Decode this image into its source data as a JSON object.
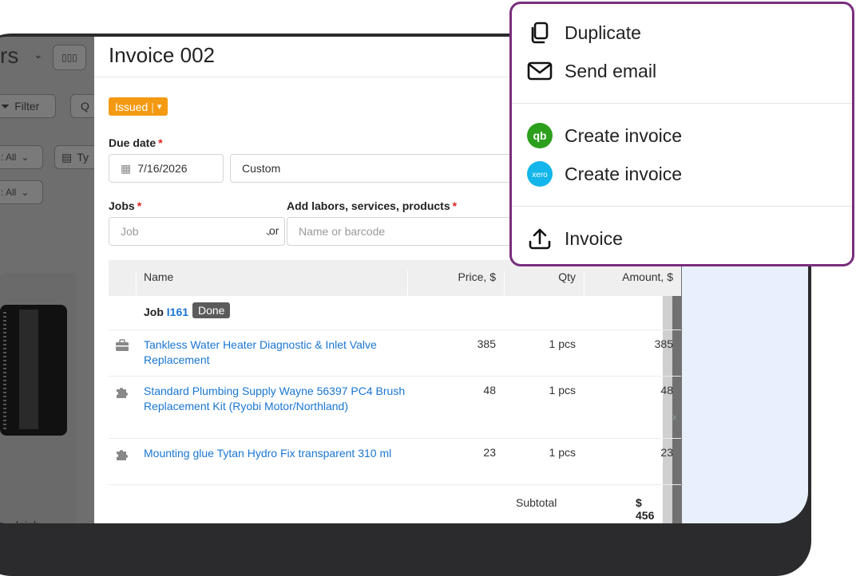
{
  "background": {
    "title_fragment": "rs",
    "filter_label": "Filter",
    "filter2_fragment": "Q",
    "status_filter_1": ": All",
    "status_filter_2": ": All",
    "type_fragment": "Ty",
    "bottom_fragment": "leigh"
  },
  "invoice": {
    "title": "Invoice 002",
    "status": "Issued",
    "due_date_label": "Due date",
    "due_date_value": "7/16/2026",
    "due_term": "Custom",
    "jobs_label": "Jobs",
    "jobs_placeholder": "Job",
    "or_label": "or",
    "add_label": "Add labors, services, products",
    "add_placeholder": "Name or barcode",
    "columns": {
      "name": "Name",
      "price": "Price, $",
      "qty": "Qty",
      "amount": "Amount, $"
    },
    "job_group": {
      "prefix": "Job",
      "id": "I161",
      "badge": "Done"
    },
    "rows": [
      {
        "icon": "toolbox-icon",
        "name": "Tankless Water Heater Diagnostic & Inlet Valve Replacement",
        "price": "385",
        "qty": "1 pcs",
        "amount": "385"
      },
      {
        "icon": "puzzle-icon",
        "name": "Standard Plumbing Supply Wayne 56397 PC4 Brush Replacement Kit (Ryobi Motor/Northland)",
        "price": "48",
        "qty": "1 pcs",
        "amount": "48"
      },
      {
        "icon": "puzzle-icon",
        "name": "Mounting glue Tytan Hydro Fix transparent 310 ml",
        "price": "23",
        "qty": "1 pcs",
        "amount": "23"
      }
    ],
    "subtotal_label": "Subtotal",
    "subtotal_value": "$ 456"
  },
  "menu": {
    "items": [
      {
        "icon": "duplicate-icon",
        "label": "Duplicate"
      },
      {
        "icon": "email-icon",
        "label": "Send email"
      },
      {
        "icon": "quickbooks-icon",
        "label": "Create invoice"
      },
      {
        "icon": "xero-icon",
        "label": "Create invoice",
        "icon_text": "xero"
      },
      {
        "icon": "upload-icon",
        "label": "Invoice"
      }
    ],
    "quickbooks_icon_text": "qb",
    "colors": {
      "border": "#7a2d7d",
      "quickbooks": "#2ca01c",
      "xero": "#13b5ea",
      "status": "#f39a12",
      "link": "#1976d2"
    }
  }
}
